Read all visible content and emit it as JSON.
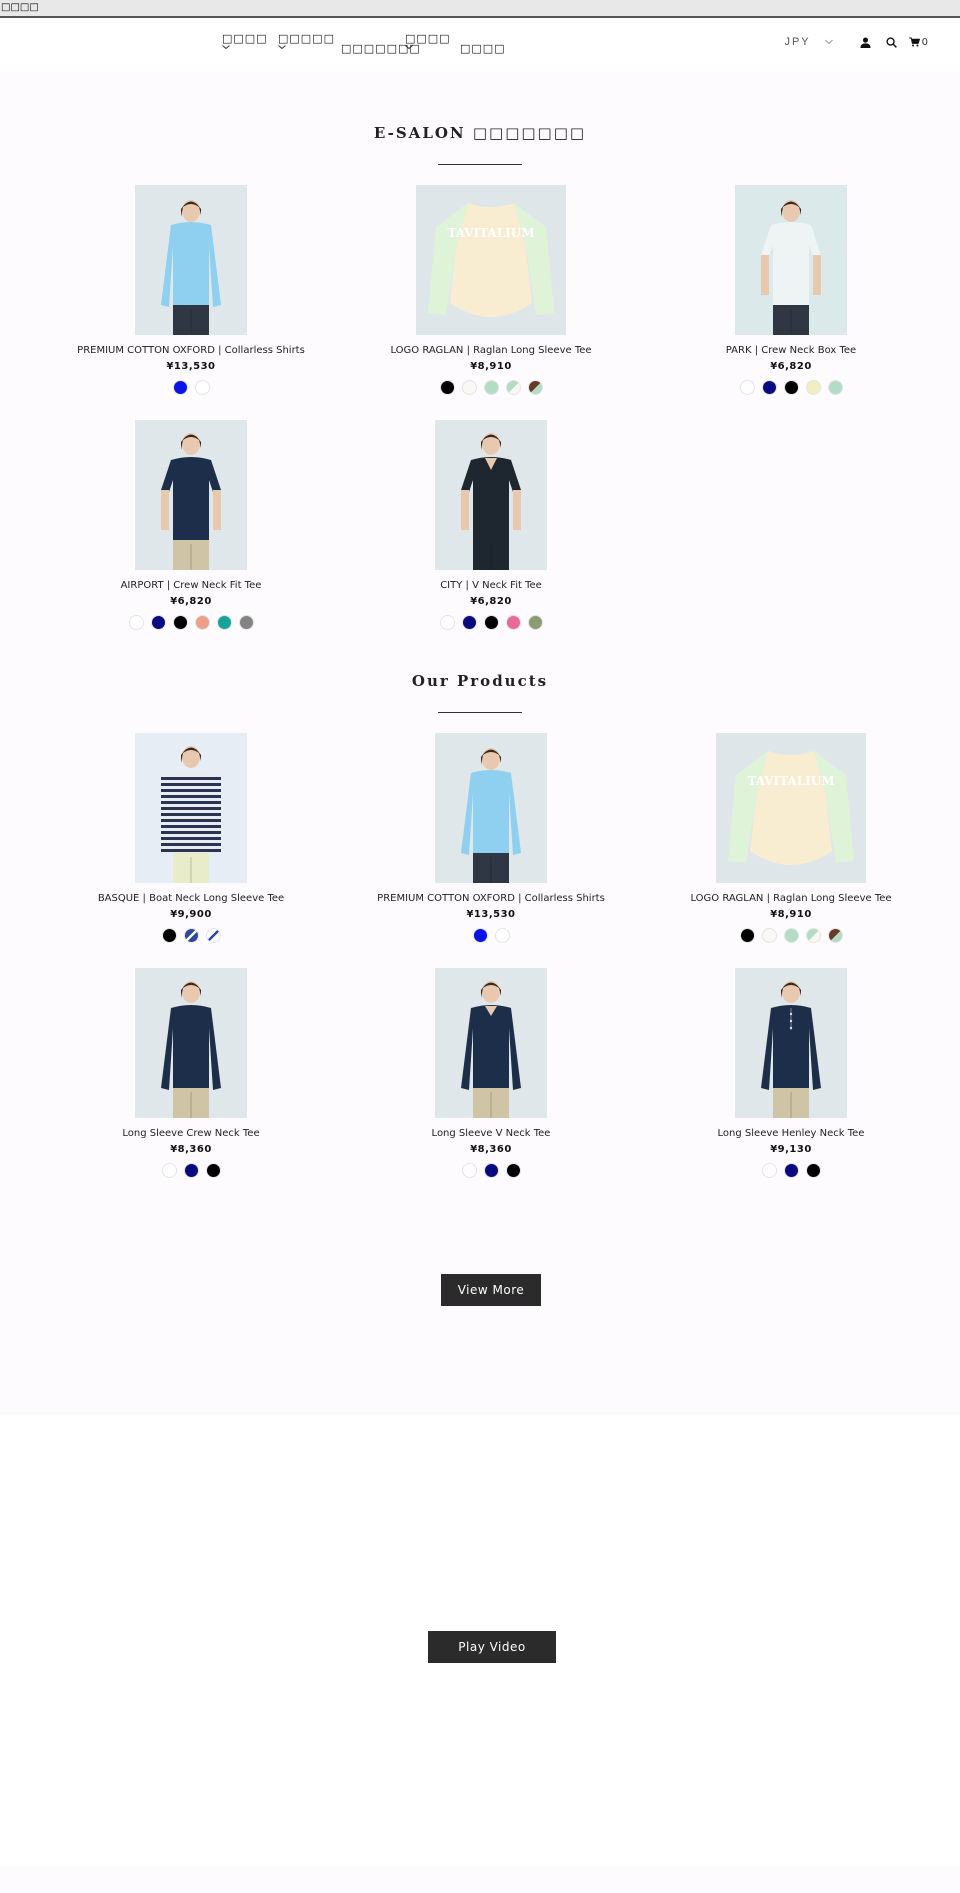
{
  "topbar": {
    "text": "□□□□"
  },
  "nav": {
    "items": [
      {
        "label": "□□□□",
        "has_dropdown": true
      },
      {
        "label": "□□□□□",
        "has_dropdown": true
      },
      {
        "label": "□□□□□□□",
        "has_dropdown": false
      },
      {
        "label": "□□□□",
        "has_dropdown": true
      },
      {
        "label": "□□□□",
        "has_dropdown": false
      }
    ]
  },
  "header": {
    "currency": "JPY",
    "account_icon": "user-icon",
    "search_icon": "search-icon",
    "cart_icon": "cart-icon",
    "cart_count": "0"
  },
  "sections": [
    {
      "title": "E-SALON □□□□□□□",
      "products": [
        {
          "name": "PREMIUM COTTON OXFORD | Collarless Shirts",
          "price": "¥13,530",
          "image": "woman-blue-shirt",
          "swatches": [
            "#0a14e6",
            "#ffffff"
          ]
        },
        {
          "name": "LOGO RAGLAN | Raglan Long Sleeve Tee",
          "price": "¥8,910",
          "image": "raglan-tee-flatlay",
          "swatches": [
            "#000000",
            "#fbf7f2",
            "#b2dcc4",
            "split:#b2dcc4:#fbf7f2",
            "split:#6b3a24:#b2dcc4"
          ]
        },
        {
          "name": "PARK | Crew Neck Box Tee",
          "price": "¥6,820",
          "image": "woman-white-tee",
          "swatches": [
            "#ffffff",
            "#0a0a80",
            "#000000",
            "#f2eebe",
            "#b2dcc4"
          ]
        },
        {
          "name": "AIRPORT | Crew Neck Fit Tee",
          "price": "¥6,820",
          "image": "man-navy-tee",
          "swatches": [
            "#ffffff",
            "#0a0a80",
            "#000000",
            "#eaa08a",
            "#16a39a",
            "#838383"
          ]
        },
        {
          "name": "CITY | V Neck Fit Tee",
          "price": "¥6,820",
          "image": "man-black-vneck",
          "swatches": [
            "#ffffff",
            "#0a0a80",
            "#000000",
            "#e86a97",
            "#8c9c72"
          ]
        }
      ]
    },
    {
      "title": "Our Products",
      "products": [
        {
          "name": "BASQUE | Boat Neck Long Sleeve Tee",
          "price": "¥9,900",
          "image": "woman-striped-tee",
          "swatches": [
            "#000000",
            "stripe:#2a4aa2",
            "stripe:#ffffff"
          ]
        },
        {
          "name": "PREMIUM COTTON OXFORD | Collarless Shirts",
          "price": "¥13,530",
          "image": "woman-blue-shirt",
          "swatches": [
            "#0a14e6",
            "#ffffff"
          ]
        },
        {
          "name": "LOGO RAGLAN | Raglan Long Sleeve Tee",
          "price": "¥8,910",
          "image": "raglan-tee-flatlay",
          "swatches": [
            "#000000",
            "#fbf7f2",
            "#b2dcc4",
            "split:#b2dcc4:#fbf7f2",
            "split:#6b3a24:#b2dcc4"
          ]
        },
        {
          "name": "Long Sleeve Crew Neck Tee",
          "price": "¥8,360",
          "image": "man-navy-longsleeve",
          "swatches": [
            "#ffffff",
            "#0a0a80",
            "#000000"
          ]
        },
        {
          "name": "Long Sleeve V Neck Tee",
          "price": "¥8,360",
          "image": "man-navy-vneck-longsleeve",
          "swatches": [
            "#ffffff",
            "#0a0a80",
            "#000000"
          ]
        },
        {
          "name": "Long Sleeve Henley Neck Tee",
          "price": "¥9,130",
          "image": "man-navy-henley",
          "swatches": [
            "#ffffff",
            "#0a0a80",
            "#000000"
          ]
        }
      ],
      "view_more_label": "View More"
    }
  ],
  "video": {
    "play_label": "Play Video"
  },
  "colors": {
    "button_bg": "#2b2b2b",
    "page_tint": "#fdfbfd"
  }
}
